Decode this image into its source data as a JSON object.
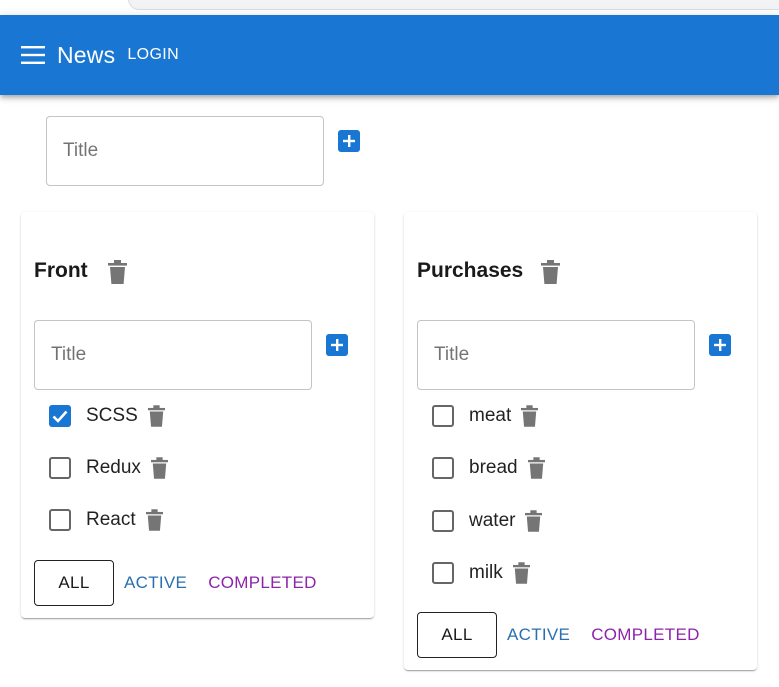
{
  "appbar": {
    "title": "News",
    "login_label": "LOGIN",
    "color": "#1976d2"
  },
  "new_list": {
    "placeholder": "Title"
  },
  "lists": [
    {
      "title": "Front",
      "input_placeholder": "Title",
      "items": [
        {
          "label": "SCSS",
          "checked": true
        },
        {
          "label": "Redux",
          "checked": false
        },
        {
          "label": "React",
          "checked": false
        }
      ],
      "filters": {
        "all": "ALL",
        "active": "ACTIVE",
        "completed": "COMPLETED"
      }
    },
    {
      "title": "Purchases",
      "input_placeholder": "Title",
      "items": [
        {
          "label": "meat",
          "checked": false
        },
        {
          "label": "bread",
          "checked": false
        },
        {
          "label": "water",
          "checked": false
        },
        {
          "label": "milk",
          "checked": false
        }
      ],
      "filters": {
        "all": "ALL",
        "active": "ACTIVE",
        "completed": "COMPLETED"
      }
    }
  ],
  "icons": {
    "menu": "menu-icon",
    "add": "add-box-icon",
    "delete": "trash-icon",
    "check": "check-icon"
  },
  "colors": {
    "primary": "#1976d2",
    "active_filter": "#2a6fb0",
    "completed_filter": "#8e24aa",
    "icon_gray": "#757575"
  }
}
